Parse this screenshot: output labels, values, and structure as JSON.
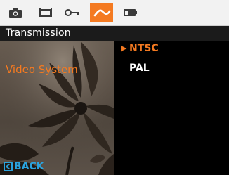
{
  "tabs": [
    {
      "icon": "camera-icon",
      "active": false
    },
    {
      "icon": "video-icon",
      "active": false
    },
    {
      "icon": "key-icon",
      "active": false
    },
    {
      "icon": "wrench-icon",
      "active": true
    },
    {
      "icon": "battery-icon",
      "active": false
    }
  ],
  "header": {
    "title": "Transmission"
  },
  "menu": {
    "item_label": "Video System"
  },
  "options": [
    {
      "label": "NTSC",
      "selected": true
    },
    {
      "label": "PAL",
      "selected": false
    }
  ],
  "footer": {
    "back_label": "BACK"
  },
  "colors": {
    "accent": "#f47a21",
    "back": "#2aa3de",
    "tabbar": "#f2f2f2"
  }
}
